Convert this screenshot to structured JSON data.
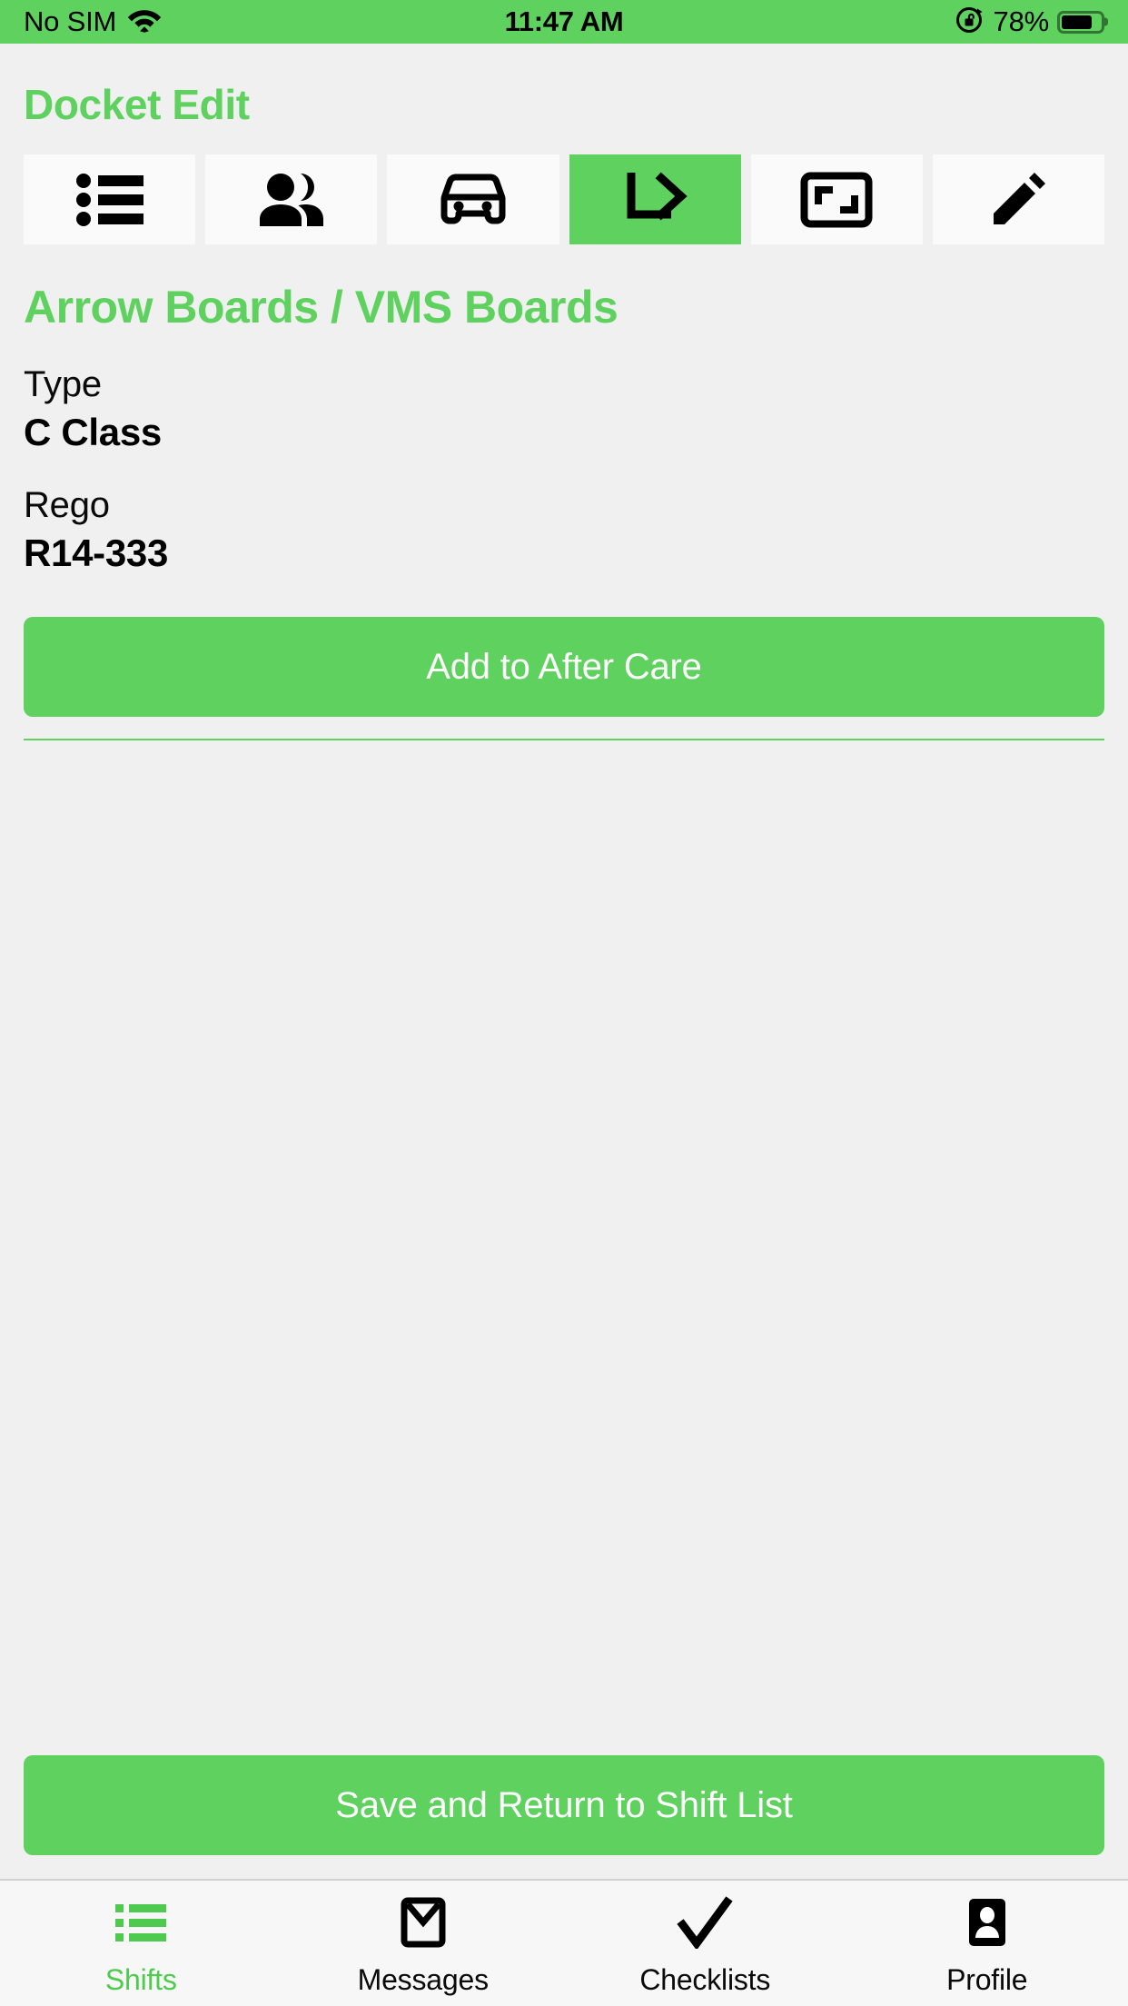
{
  "status_bar": {
    "carrier": "No SIM",
    "wifi_icon": "wifi-icon",
    "time": "11:47 AM",
    "rotation_lock_icon": "rotation-lock-icon",
    "battery_percent": "78%",
    "battery_level": 78,
    "battery_icon": "battery-icon",
    "background_color": "#5ed15e"
  },
  "header": {
    "title": "Docket Edit",
    "title_color": "#5ed15e"
  },
  "tabs": [
    {
      "name": "list",
      "icon": "list-bullet-icon",
      "active": false
    },
    {
      "name": "crew",
      "icon": "people-icon",
      "active": false
    },
    {
      "name": "vehicles",
      "icon": "car-icon",
      "active": false
    },
    {
      "name": "arrowboards",
      "icon": "turn-right-arrow-icon",
      "active": true
    },
    {
      "name": "signs",
      "icon": "board-frame-icon",
      "active": false
    },
    {
      "name": "notes",
      "icon": "pencil-icon",
      "active": false
    }
  ],
  "main": {
    "section_title": "Arrow Boards / VMS Boards",
    "fields": [
      {
        "label": "Type",
        "value": "C Class"
      },
      {
        "label": "Rego",
        "value": "R14-333"
      }
    ],
    "add_button_label": "Add to After Care",
    "save_button_label": "Save and Return to Shift List",
    "accent_color": "#5ed15e"
  },
  "bottom_nav": [
    {
      "label": "Shifts",
      "icon": "list-lines-icon",
      "active": true
    },
    {
      "label": "Messages",
      "icon": "envelope-icon",
      "active": false
    },
    {
      "label": "Checklists",
      "icon": "checkmark-icon",
      "active": false
    },
    {
      "label": "Profile",
      "icon": "contact-card-icon",
      "active": false
    }
  ]
}
